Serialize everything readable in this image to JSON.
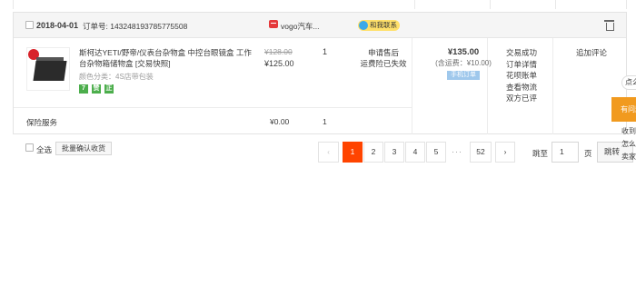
{
  "order": {
    "date": "2018-04-01",
    "order_no": "订单号: 143248193785775508",
    "shop_name": "vogo汽车...",
    "contact_label": "和我联系",
    "product_title": "斯柯达YETI/野帝/仪表台杂物盒 中控台眼镜盒 工作台杂物箱储物盒 [交易快照]",
    "variant": "颜色分类：4S店带包装",
    "tags": [
      {
        "text": "7",
        "color": "#4cae4c"
      },
      {
        "text": "赞",
        "color": "#4cae4c"
      },
      {
        "text": "正",
        "color": "#4cae4c"
      }
    ],
    "original_price": "¥128.00",
    "unit_price": "¥125.00",
    "quantity": "1",
    "after_sale": [
      "申请售后",
      "运费险已失效"
    ],
    "total": "¥135.00",
    "shipping_note": "(含运费：¥10.00)",
    "phone_order_badge": "手机订单",
    "status_links": [
      "交易成功",
      "订单详情",
      "花呗账单",
      "查看物流",
      "双方已评"
    ],
    "review_link": "追加评论",
    "service_label": "保险服务",
    "service_price": "¥0.00",
    "service_qty": "1"
  },
  "footer": {
    "select_all": "全选",
    "batch_confirm": "批量确认收货"
  },
  "pagination": {
    "prev": "‹",
    "pages": [
      "1",
      "2",
      "3",
      "4",
      "5"
    ],
    "ellipsis": "···",
    "last": "52",
    "next": "›",
    "current_page": "1",
    "jump_label": "跳至",
    "jump_value": "1",
    "page_unit": "页",
    "jump_button": "跳转"
  },
  "side_panel": {
    "bubble": "点么",
    "orange_button": "有问题",
    "lines": [
      "收到",
      "怎么",
      "卖家不"
    ]
  },
  "colors": {
    "accent": "#ff4400",
    "orange": "#f19a1f",
    "contact_yellow": "#ffe06a",
    "contact_blue": "#3ba9e8",
    "phone_badge": "#9fc8ec"
  }
}
